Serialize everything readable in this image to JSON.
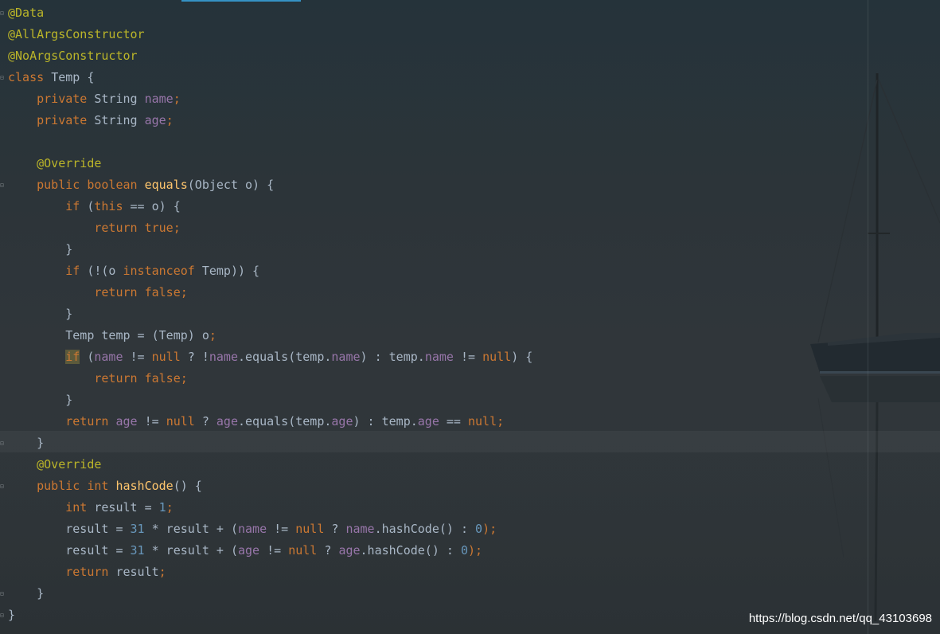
{
  "editor": {
    "background_accent": "#3592c4",
    "lines": [
      [
        {
          "t": "@Data",
          "c": "ann"
        }
      ],
      [
        {
          "t": "@AllArgsConstructor",
          "c": "ann"
        }
      ],
      [
        {
          "t": "@NoArgsConstructor",
          "c": "ann"
        }
      ],
      [
        {
          "t": "class ",
          "c": "kw"
        },
        {
          "t": "Temp {",
          "c": "pl"
        }
      ],
      [
        {
          "t": "    "
        },
        {
          "t": "private ",
          "c": "kw"
        },
        {
          "t": "String ",
          "c": "pl"
        },
        {
          "t": "name",
          "c": "fld"
        },
        {
          "t": ";",
          "c": "kw"
        }
      ],
      [
        {
          "t": "    "
        },
        {
          "t": "private ",
          "c": "kw"
        },
        {
          "t": "String ",
          "c": "pl"
        },
        {
          "t": "age",
          "c": "fld"
        },
        {
          "t": ";",
          "c": "kw"
        }
      ],
      [],
      [
        {
          "t": "    "
        },
        {
          "t": "@Override",
          "c": "ann"
        }
      ],
      [
        {
          "t": "    "
        },
        {
          "t": "public boolean ",
          "c": "kw"
        },
        {
          "t": "equals",
          "c": "mth"
        },
        {
          "t": "(Object o) {",
          "c": "pl"
        }
      ],
      [
        {
          "t": "        "
        },
        {
          "t": "if ",
          "c": "kw"
        },
        {
          "t": "(",
          "c": "pl"
        },
        {
          "t": "this ",
          "c": "kw"
        },
        {
          "t": "== o) {",
          "c": "pl"
        }
      ],
      [
        {
          "t": "            "
        },
        {
          "t": "return true;",
          "c": "kw"
        }
      ],
      [
        {
          "t": "        }",
          "c": "pl"
        }
      ],
      [
        {
          "t": "        "
        },
        {
          "t": "if ",
          "c": "kw"
        },
        {
          "t": "(!(o ",
          "c": "pl"
        },
        {
          "t": "instanceof ",
          "c": "kw"
        },
        {
          "t": "Temp)) {",
          "c": "pl"
        }
      ],
      [
        {
          "t": "            "
        },
        {
          "t": "return false;",
          "c": "kw"
        }
      ],
      [
        {
          "t": "        }",
          "c": "pl"
        }
      ],
      [
        {
          "t": "        Temp temp = (Temp) o",
          "c": "pl"
        },
        {
          "t": ";",
          "c": "kw"
        }
      ],
      [
        {
          "t": "        "
        },
        {
          "t": "if",
          "c": "kw hl"
        },
        {
          "t": " (",
          "c": "pl"
        },
        {
          "t": "name",
          "c": "fld"
        },
        {
          "t": " != ",
          "c": "pl"
        },
        {
          "t": "null",
          "c": "kw"
        },
        {
          "t": " ? !",
          "c": "pl"
        },
        {
          "t": "name",
          "c": "fld"
        },
        {
          "t": ".equals(temp.",
          "c": "pl"
        },
        {
          "t": "name",
          "c": "fld"
        },
        {
          "t": ") : temp.",
          "c": "pl"
        },
        {
          "t": "name",
          "c": "fld"
        },
        {
          "t": " != ",
          "c": "pl"
        },
        {
          "t": "null",
          "c": "kw"
        },
        {
          "t": ") {",
          "c": "pl"
        }
      ],
      [
        {
          "t": "            "
        },
        {
          "t": "return false;",
          "c": "kw"
        }
      ],
      [
        {
          "t": "        }",
          "c": "pl"
        }
      ],
      [
        {
          "t": "        "
        },
        {
          "t": "return ",
          "c": "kw"
        },
        {
          "t": "age",
          "c": "fld"
        },
        {
          "t": " != ",
          "c": "pl"
        },
        {
          "t": "null",
          "c": "kw"
        },
        {
          "t": " ? ",
          "c": "pl"
        },
        {
          "t": "age",
          "c": "fld"
        },
        {
          "t": ".equals(temp.",
          "c": "pl"
        },
        {
          "t": "age",
          "c": "fld"
        },
        {
          "t": ") : temp.",
          "c": "pl"
        },
        {
          "t": "age",
          "c": "fld"
        },
        {
          "t": " == ",
          "c": "pl"
        },
        {
          "t": "null;",
          "c": "kw"
        }
      ],
      [
        {
          "t": "    }",
          "c": "pl"
        }
      ],
      [
        {
          "t": "    "
        },
        {
          "t": "@Override",
          "c": "ann"
        }
      ],
      [
        {
          "t": "    "
        },
        {
          "t": "public int ",
          "c": "kw"
        },
        {
          "t": "hashCode",
          "c": "mth"
        },
        {
          "t": "() {",
          "c": "pl"
        }
      ],
      [
        {
          "t": "        "
        },
        {
          "t": "int ",
          "c": "kw"
        },
        {
          "t": "result = ",
          "c": "pl"
        },
        {
          "t": "1",
          "c": "num"
        },
        {
          "t": ";",
          "c": "kw"
        }
      ],
      [
        {
          "t": "        result = ",
          "c": "pl"
        },
        {
          "t": "31",
          "c": "num"
        },
        {
          "t": " * result + (",
          "c": "pl"
        },
        {
          "t": "name",
          "c": "fld"
        },
        {
          "t": " != ",
          "c": "pl"
        },
        {
          "t": "null",
          "c": "kw"
        },
        {
          "t": " ? ",
          "c": "pl"
        },
        {
          "t": "name",
          "c": "fld"
        },
        {
          "t": ".hashCode() : ",
          "c": "pl"
        },
        {
          "t": "0",
          "c": "num"
        },
        {
          "t": ");",
          "c": "kw"
        }
      ],
      [
        {
          "t": "        result = ",
          "c": "pl"
        },
        {
          "t": "31",
          "c": "num"
        },
        {
          "t": " * result + (",
          "c": "pl"
        },
        {
          "t": "age",
          "c": "fld"
        },
        {
          "t": " != ",
          "c": "pl"
        },
        {
          "t": "null",
          "c": "kw"
        },
        {
          "t": " ? ",
          "c": "pl"
        },
        {
          "t": "age",
          "c": "fld"
        },
        {
          "t": ".hashCode() : ",
          "c": "pl"
        },
        {
          "t": "0",
          "c": "num"
        },
        {
          "t": ");",
          "c": "kw"
        }
      ],
      [
        {
          "t": "        "
        },
        {
          "t": "return ",
          "c": "kw"
        },
        {
          "t": "result",
          "c": "pl"
        },
        {
          "t": ";",
          "c": "kw"
        }
      ],
      [
        {
          "t": "    }",
          "c": "pl"
        }
      ],
      [
        {
          "t": "}",
          "c": "pl"
        }
      ]
    ]
  },
  "colors": {
    "keyword": "#cc7832",
    "annotation": "#bbb529",
    "field": "#9876aa",
    "method": "#ffc66d",
    "number": "#6897bb",
    "plain": "#a9b7c6"
  },
  "watermark": {
    "text": "https://blog.csdn.net/qq_43103698"
  }
}
